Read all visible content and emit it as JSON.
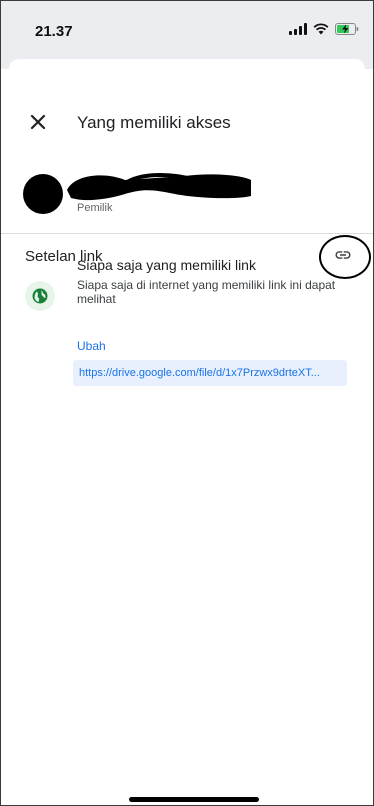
{
  "status_bar": {
    "time": "21.37",
    "icons": [
      "signal-icon",
      "wifi-icon",
      "battery-charging-icon"
    ]
  },
  "header": {
    "title": "Yang memiliki akses",
    "close_icon": "close-icon"
  },
  "owner": {
    "role": "Pemilik"
  },
  "link_settings": {
    "title": "Setelan link",
    "link_icon": "link-icon",
    "access": {
      "title": "Siapa saja yang memiliki link",
      "description": "Siapa saja di internet yang memiliki link ini dapat melihat",
      "change_label": "Ubah",
      "url": "https://drive.google.com/file/d/1x7Przwx9drteXT..."
    }
  },
  "colors": {
    "accent": "#1a73e8",
    "url_bg": "#e8f0fe",
    "globe": "#188038"
  }
}
